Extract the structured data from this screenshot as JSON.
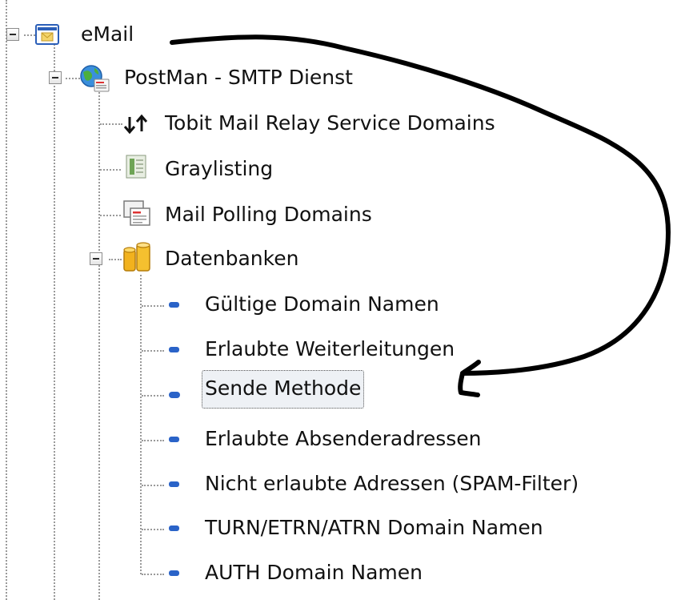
{
  "tree": {
    "root": {
      "label": "eMail",
      "icon": "envelope-folder-icon",
      "expanded": true
    },
    "service": {
      "label": "PostMan -  SMTP Dienst",
      "icon": "globe-mail-icon",
      "expanded": true
    },
    "service_children": [
      {
        "label": "Tobit Mail Relay Service Domains",
        "icon": "relay-arrows-icon"
      },
      {
        "label": "Graylisting",
        "icon": "graylisting-icon"
      },
      {
        "label": "Mail Polling Domains",
        "icon": "mail-polling-icon"
      }
    ],
    "databases": {
      "label": "Datenbanken",
      "icon": "database-icon",
      "expanded": true
    },
    "database_children": [
      {
        "label": "Gültige Domain Namen",
        "icon": "dash-icon",
        "selected": false
      },
      {
        "label": "Erlaubte Weiterleitungen",
        "icon": "dash-icon",
        "selected": false
      },
      {
        "label": "Sende Methode",
        "icon": "dash-icon",
        "selected": true
      },
      {
        "label": "Erlaubte Absenderadressen",
        "icon": "dash-icon",
        "selected": false
      },
      {
        "label": "Nicht erlaubte Adressen (SPAM-Filter)",
        "icon": "dash-icon",
        "selected": false
      },
      {
        "label": "TURN/ETRN/ATRN Domain Namen",
        "icon": "dash-icon",
        "selected": false
      },
      {
        "label": "AUTH Domain Namen",
        "icon": "dash-icon",
        "selected": false
      }
    ]
  },
  "annotation": {
    "type": "hand-drawn-arrow",
    "color": "#000000"
  },
  "colors": {
    "selected_background": "#eef1f5",
    "dash_icon": "#2a63c8",
    "connector": "#9a9a9a"
  }
}
